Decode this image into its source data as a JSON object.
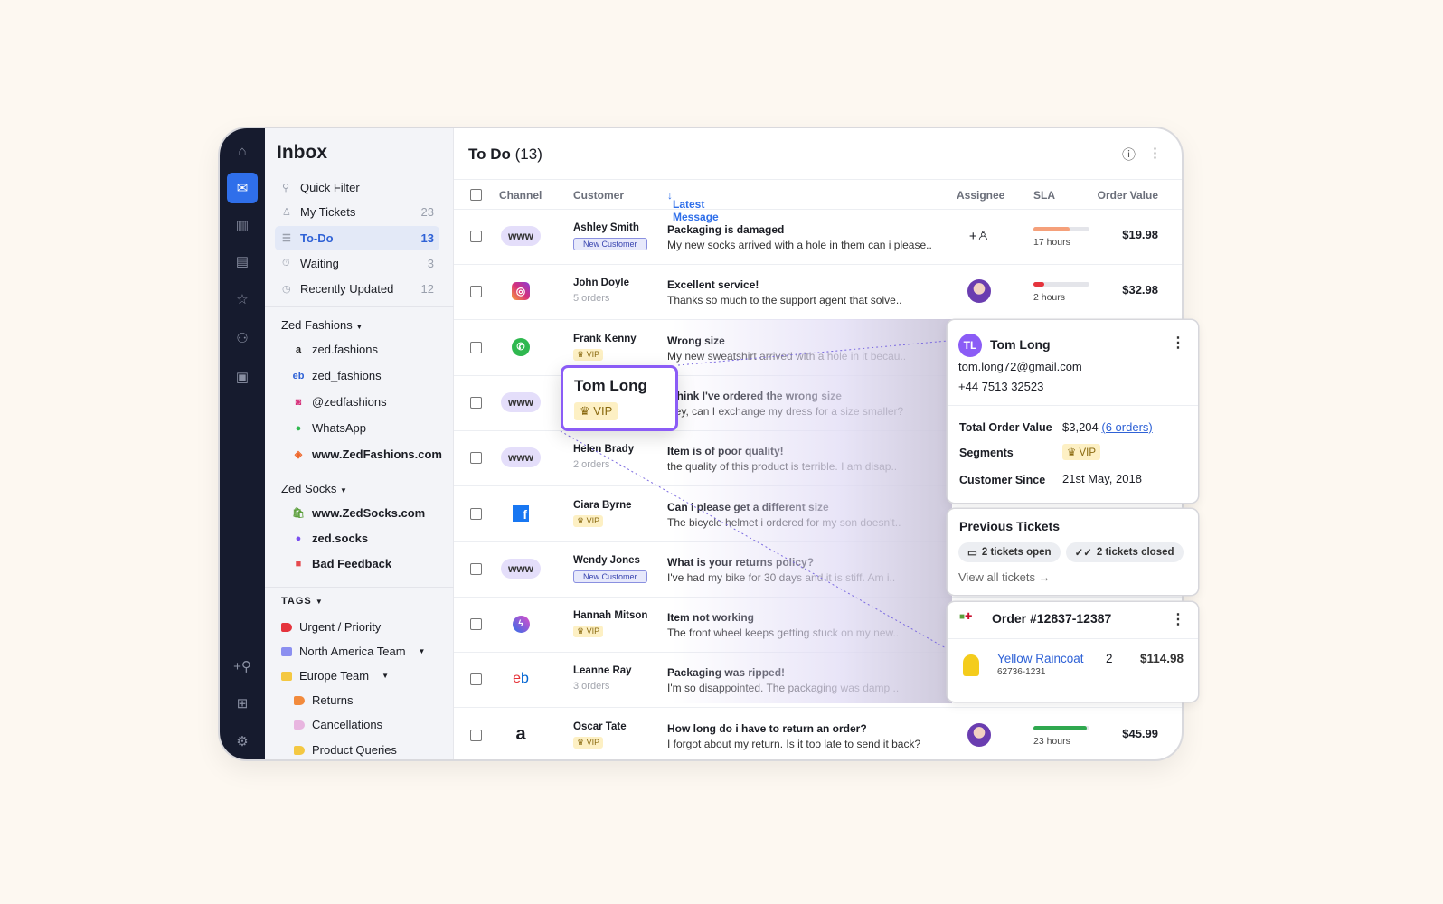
{
  "nav": {
    "title": "Inbox",
    "items": [
      {
        "label": "Quick Filter",
        "icon": "search-icon",
        "count": ""
      },
      {
        "label": "My Tickets",
        "icon": "user-icon",
        "count": "23"
      },
      {
        "label": "To-Do",
        "icon": "list-icon",
        "count": "13"
      },
      {
        "label": "Waiting",
        "icon": "timer-icon",
        "count": "3"
      },
      {
        "label": "Recently Updated",
        "icon": "clock-icon",
        "count": "12"
      }
    ],
    "groups": [
      {
        "label": "Zed Fashions",
        "items": [
          {
            "label": "zed.fashions",
            "icon": "amazon-icon"
          },
          {
            "label": "zed_fashions",
            "icon": "ebay-icon"
          },
          {
            "label": "@zedfashions",
            "icon": "instagram-icon"
          },
          {
            "label": "WhatsApp",
            "icon": "whatsapp-icon"
          },
          {
            "label": "www.ZedFashions.com",
            "icon": "magento-icon"
          }
        ]
      },
      {
        "label": "Zed Socks",
        "items": [
          {
            "label": "www.ZedSocks.com",
            "icon": "shopify-icon"
          },
          {
            "label": "zed.socks",
            "icon": "messenger-icon"
          },
          {
            "label": "Bad Feedback",
            "icon": "tag-icon",
            "color": "#e5484d"
          }
        ]
      }
    ],
    "tags_label": "TAGS",
    "tags": [
      {
        "label": "Urgent / Priority",
        "color": "#e5343d"
      },
      {
        "label": "North America Team",
        "color": "#8b8ff0"
      },
      {
        "label": "Europe Team",
        "color": "#f4c842"
      },
      {
        "label": "Returns",
        "color": "#f28a3c"
      },
      {
        "label": "Cancellations",
        "color": "#e8b5e0"
      },
      {
        "label": "Product Queries",
        "color": "#f4c842"
      }
    ]
  },
  "main": {
    "title": "To Do",
    "count": "(13)",
    "columns": {
      "channel": "Channel",
      "customer": "Customer",
      "latest": "Latest Message",
      "assignee": "Assignee",
      "sla": "SLA",
      "order_value": "Order Value"
    },
    "rows": [
      {
        "channel": "www",
        "name": "Ashley Smith",
        "badge": "New Customer",
        "subject": "Packaging is damaged",
        "preview": "My new socks arrived with a hole in them can i please..",
        "assignee": "add",
        "sla": 0.65,
        "sla_color": "#f5a07a",
        "sla_label": "17 hours",
        "value": "$19.98"
      },
      {
        "channel": "instagram",
        "name": "John Doyle",
        "orders": "5 orders",
        "subject": "Excellent service!",
        "preview": "Thanks so much to the support agent that solve..",
        "assignee": "avatar",
        "sla": 0.2,
        "sla_color": "#e5343d",
        "sla_label": "2 hours",
        "value": "$32.98"
      },
      {
        "channel": "whatsapp",
        "name": "Frank Kenny",
        "badge": "VIP",
        "subject": "Wrong size",
        "preview": "My new sweatshirt arrived with a hole in it becau.."
      },
      {
        "channel": "www",
        "name": "Tom Long",
        "badge": "VIP",
        "subject": "I think I've ordered the wrong size",
        "preview": "Hey, can I exchange my dress for a size smaller?"
      },
      {
        "channel": "www",
        "name": "Helen Brady",
        "orders": "2 orders",
        "subject": "Item is of poor quality!",
        "preview": "the quality of this product is terrible. I am disap.."
      },
      {
        "channel": "facebook",
        "name": "Ciara Byrne",
        "badge": "VIP",
        "subject": "Can i please get a different size",
        "preview": "The bicycle helmet i ordered for my son doesn't.."
      },
      {
        "channel": "www",
        "name": "Wendy Jones",
        "badge": "New Customer",
        "subject": "What is your returns policy?",
        "preview": "I've had my bike for 30 days and it is stiff. Am i.."
      },
      {
        "channel": "messenger",
        "name": "Hannah Mitson",
        "badge": "VIP",
        "subject": "Item not working",
        "preview": "The front wheel keeps getting stuck on my new.."
      },
      {
        "channel": "ebay",
        "name": "Leanne Ray",
        "orders": "3 orders",
        "subject": "Packaging was ripped!",
        "preview": "I'm so disappointed. The packaging was damp .."
      },
      {
        "channel": "amazon",
        "name": "Oscar Tate",
        "badge": "VIP",
        "subject": "How long do i have to return an order?",
        "preview": "I forgot about my return. Is it too late to send it back?",
        "assignee": "avatar",
        "sla": 0.95,
        "sla_color": "#2fa84f",
        "sla_label": "23 hours",
        "value": "$45.99"
      }
    ]
  },
  "popup": {
    "name": "Tom Long",
    "badge": "VIP"
  },
  "customer": {
    "initials": "TL",
    "name": "Tom Long",
    "email": "tom.long72@gmail.com",
    "phone": "+44 7513 32523",
    "total_label": "Total Order Value",
    "total": "$3,204",
    "orders_link": "(6 orders)",
    "segments_label": "Segments",
    "segment": "VIP",
    "since_label": "Customer Since",
    "since": "21st May, 2018"
  },
  "tickets": {
    "title": "Previous Tickets",
    "open": "2 tickets open",
    "closed": "2 tickets closed",
    "view_all": "View all tickets →"
  },
  "order": {
    "title": "Order #12837-12387",
    "item": "Yellow Raincoat",
    "sku": "62736-1231",
    "qty": "2",
    "price": "$114.98"
  },
  "colors": {
    "accent": "#2f6fea",
    "rail": "#161b2e",
    "highlight": "#8b5cf6"
  }
}
